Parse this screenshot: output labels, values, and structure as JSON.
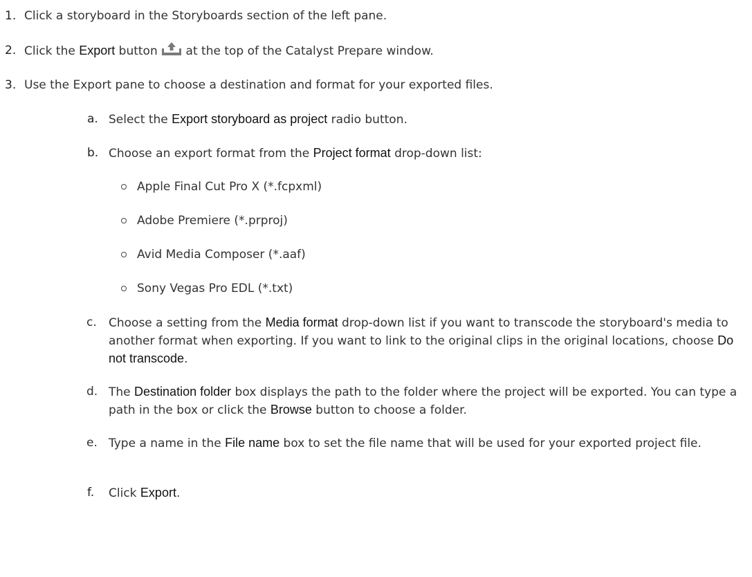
{
  "steps": [
    {
      "number": "1.",
      "text_a": "Click a storyboard in the Storyboards section of the left pane."
    },
    {
      "number": "2.",
      "text_a": "Click the ",
      "bold_a": "Export",
      "text_b": " button ",
      "icon": "export-upload-icon",
      "text_c": " at the top of the Catalyst Prepare window."
    },
    {
      "number": "3.",
      "text_a": "Use the Export pane to choose a destination and format for your exported files."
    }
  ],
  "substeps": [
    {
      "label": "a.",
      "text_a": "Select the ",
      "bold_a": "Export storyboard as project",
      "text_b": " radio button."
    },
    {
      "label": "b.",
      "text_a": "Choose an export format from the ",
      "bold_a": "Project format",
      "text_b": " drop-down list:"
    },
    {
      "label": "c.",
      "text_a": "Choose a setting from the ",
      "bold_a": "Media format",
      "text_b": " drop-down list if you want to transcode the storyboard's media to another format when exporting. If you want to link to the original clips in the original locations, choose ",
      "bold_b": "Do not transcode",
      "text_c": "."
    },
    {
      "label": "d.",
      "text_a": "The ",
      "bold_a": "Destination folder",
      "text_b": " box displays the path to the folder where the project will be exported. You can type a path in the box or click the ",
      "bold_b": "Browse",
      "text_c": " button to choose a folder."
    },
    {
      "label": "e.",
      "text_a": "Type a name in the ",
      "bold_a": "File name",
      "text_b": " box to set the file name that will be used for your exported project file."
    },
    {
      "label": "f.",
      "text_a": "Click ",
      "bold_a": "Export",
      "text_b": "."
    }
  ],
  "formats": [
    "Apple Final Cut Pro X (*.fcpxml)",
    "Adobe Premiere (*.prproj)",
    "Avid Media Composer (*.aaf)",
    "Sony Vegas Pro EDL (*.txt)"
  ],
  "colors": {
    "text": "#333333",
    "bold_text": "#111111",
    "icon": "#7a7a7a"
  }
}
